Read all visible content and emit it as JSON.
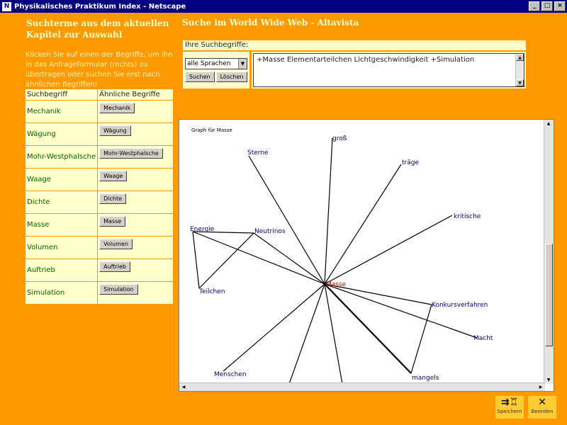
{
  "window": {
    "title": "Physikalisches Praktikum Index - Netscape"
  },
  "left": {
    "heading": "Suchterme aus dem aktuellen Kapitel zur Auswahl",
    "intro": "Klicken Sie auf einen der Begriffe, um ihn in das Anfrageformular (rechts) zu übertragen oder suchen Sie erst nach ähnlichen Begriffen!",
    "table": {
      "header_term": "Suchbegriff",
      "header_similar": "Ähnliche Begriffe",
      "rows": [
        {
          "term": "Mechanik",
          "button": "Mechanik"
        },
        {
          "term": "Wägung",
          "button": "Wägung"
        },
        {
          "term": "Mohr-Westphalsche",
          "button": "Mohr-Westphalsche"
        },
        {
          "term": "Waage",
          "button": "Waage"
        },
        {
          "term": "Dichte",
          "button": "Dichte"
        },
        {
          "term": "Masse",
          "button": "Masse"
        },
        {
          "term": "Volumen",
          "button": "Volumen"
        },
        {
          "term": "Auftrieb",
          "button": "Auftrieb"
        },
        {
          "term": "Simulation",
          "button": "Simulation"
        }
      ]
    }
  },
  "right": {
    "heading": "Suche im World Wide Web - Altavista",
    "search_label": "Ihre Suchbegriffe:",
    "language_select": "alle Sprachen",
    "search_button": "Suchen",
    "clear_button": "Löschen",
    "query": "+Masse Elementarteilchen Lichtgeschwindigkeit +Simulation"
  },
  "graph": {
    "title": "Graph für Masse",
    "center": "Masse",
    "nodes": [
      "groß",
      "Sterne",
      "träge",
      "kritische",
      "Energie",
      "Neutrinos",
      "Teilchen",
      "Konkursverfahren",
      "Macht",
      "mangels",
      "Menschen"
    ]
  },
  "actions": {
    "save": "Speichern",
    "quit": "Beenden"
  },
  "icons": {
    "save": "save-print-icon",
    "quit": "close-x-icon"
  },
  "colors": {
    "background": "#ff9900",
    "panel": "#ffffcc",
    "graph_node": "#000080",
    "graph_center": "#cc0000"
  }
}
